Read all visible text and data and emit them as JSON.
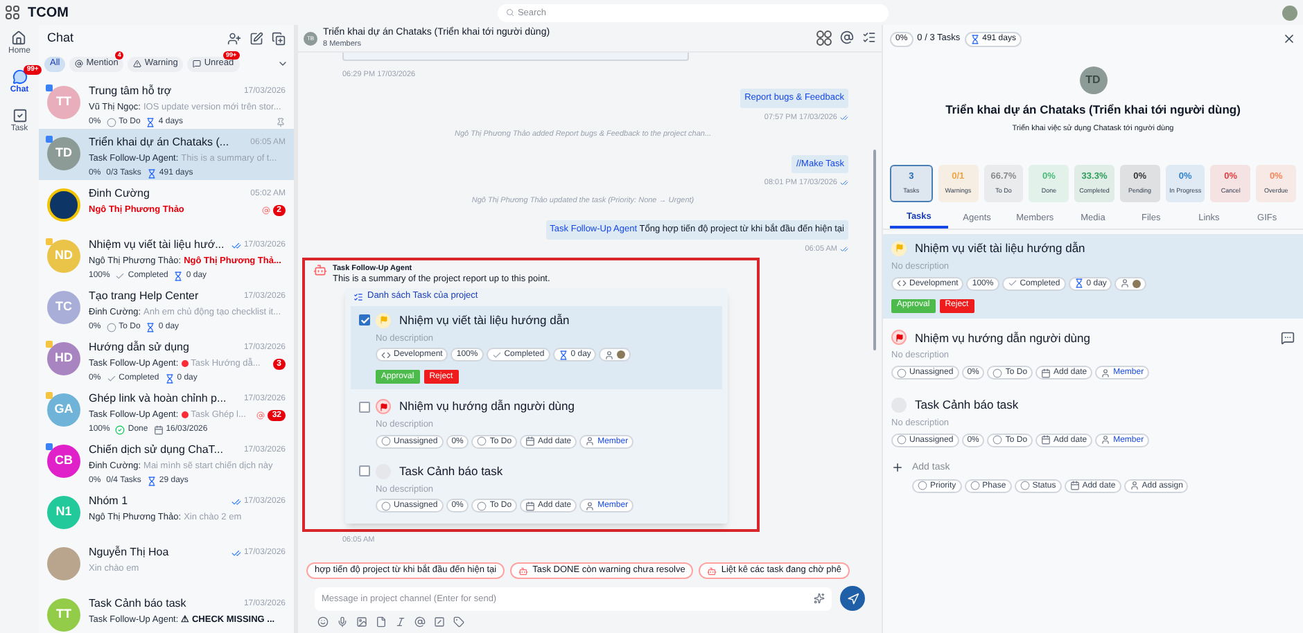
{
  "app": {
    "title": "TCOM"
  },
  "search": {
    "placeholder": "Search"
  },
  "rail": [
    {
      "label": "Home",
      "selected": false
    },
    {
      "label": "Chat",
      "selected": true,
      "badge": "99+"
    },
    {
      "label": "Task",
      "selected": false
    }
  ],
  "chat_list": {
    "title": "Chat",
    "filters": [
      {
        "label": "All",
        "selected": true
      },
      {
        "label": "Mention",
        "selected": false,
        "badge": "4"
      },
      {
        "label": "Warning",
        "selected": false
      },
      {
        "label": "Unread",
        "selected": false,
        "badge": "99+"
      }
    ],
    "conversations": [
      {
        "kind": "initials",
        "initials": "TT",
        "color": "#e8aebb",
        "tag": {
          "color": "#3b82f6"
        },
        "name": "Trung tâm hỗ trợ",
        "time": "17/03/2026",
        "sender": "Vũ Thị Ngọc:",
        "preview": "IOS update version mới trên stor...",
        "selected": false,
        "pinned": true,
        "meta": [
          {
            "kind": "percent",
            "text": "0%"
          },
          {
            "kind": "todo",
            "text": "To Do"
          },
          {
            "kind": "duration",
            "text": "4 days"
          }
        ]
      },
      {
        "kind": "initials",
        "initials": "TD",
        "color": "#8c9b96",
        "tag": {
          "color": "#3b82f6"
        },
        "name": "Triển khai dự án Chataks (...",
        "time": "06:05 AM",
        "sender": "Task Follow-Up Agent:",
        "preview": "This is a summary of t...",
        "selected": true,
        "meta": [
          {
            "kind": "percent",
            "text": "0%"
          },
          {
            "kind": "tasks",
            "text": "0/3 Tasks"
          },
          {
            "kind": "duration",
            "text": "491 days"
          }
        ]
      },
      {
        "kind": "logo",
        "name": "Đinh Cường",
        "time": "05:02 AM",
        "preview": "Ngô Thị Phương Thảo",
        "alert": true,
        "selected": false,
        "mention": true,
        "badge": "2"
      },
      {
        "kind": "initials",
        "initials": "ND",
        "color": "#e9c449",
        "tag": {
          "color": "#f5c542"
        },
        "name": "Nhiệm vụ viết tài liệu hướ...",
        "time": "17/03/2026",
        "ticks": true,
        "sender": "Ngô Thị Phương Thảo:",
        "preview": "Ngô Thị Phương Thả...",
        "alert": true,
        "selected": false,
        "meta": [
          {
            "kind": "percent",
            "text": "100%"
          },
          {
            "kind": "completed",
            "text": "Completed"
          },
          {
            "kind": "duration",
            "text": "0 day"
          }
        ]
      },
      {
        "kind": "initials",
        "initials": "TC",
        "color": "#a9aed8",
        "name": "Tạo trang Help Center",
        "time": "17/03/2026",
        "sender": "Đinh Cường:",
        "preview": "Anh em chủ động tạo checklist it...",
        "selected": false,
        "meta": [
          {
            "kind": "percent",
            "text": "0%"
          },
          {
            "kind": "todo",
            "text": "To Do"
          },
          {
            "kind": "duration",
            "text": "0 day"
          }
        ]
      },
      {
        "kind": "initials",
        "initials": "HD",
        "color": "#a884c0",
        "tag": {
          "color": "#f5c542"
        },
        "name": "Hướng dẫn sử dụng",
        "time": "17/03/2026",
        "sender": "Task Follow-Up Agent:",
        "alert_dot": true,
        "preview": "Task Hướng dẫ...",
        "selected": false,
        "badge": "3",
        "meta": [
          {
            "kind": "percent",
            "text": "0%"
          },
          {
            "kind": "completed",
            "text": "Completed"
          },
          {
            "kind": "duration",
            "text": "0 day"
          }
        ]
      },
      {
        "kind": "initials",
        "initials": "GA",
        "color": "#6fb3d8",
        "tag": {
          "color": "#f5c542"
        },
        "name": "Ghép link và hoàn chỉnh p...",
        "time": "17/03/2026",
        "sender": "Task Follow-Up Agent:",
        "alert_dot": true,
        "preview": "Task Ghép l...",
        "selected": false,
        "mention": true,
        "badge": "32",
        "meta": [
          {
            "kind": "percent",
            "text": "100%"
          },
          {
            "kind": "done",
            "text": "Done"
          },
          {
            "kind": "date",
            "text": "16/03/2026"
          }
        ]
      },
      {
        "kind": "initials",
        "initials": "CB",
        "color": "#e020c8",
        "tag": {
          "color": "#3b82f6"
        },
        "name": "Chiến dịch sử dụng ChaT...",
        "time": "17/03/2026",
        "sender": "Đinh Cường:",
        "preview": "Mai mình sẽ start chiến dịch này",
        "selected": false,
        "meta": [
          {
            "kind": "percent",
            "text": "0%"
          },
          {
            "kind": "tasks",
            "text": "0/4 Tasks"
          },
          {
            "kind": "duration",
            "text": "29 days"
          }
        ]
      },
      {
        "kind": "initials",
        "initials": "N1",
        "color": "#22c99a",
        "name": "Nhóm 1",
        "time": "17/03/2026",
        "ticks": true,
        "sender": "Ngô Thị Phương Thảo:",
        "preview": "Xin chào 2 em",
        "selected": false
      },
      {
        "kind": "photo",
        "name": "Nguyễn Thị Hoa",
        "time": "17/03/2026",
        "ticks": true,
        "preview": "Xin chào em",
        "selected": false
      },
      {
        "kind": "initials",
        "initials": "TT",
        "color": "#93cc48",
        "name": "Task Cảnh báo task",
        "time": "17/03/2026",
        "sender": "Task Follow-Up Agent:",
        "preview": "⚠ CHECK MISSING ...",
        "bold": true,
        "selected": false
      }
    ]
  },
  "channel": {
    "initials": "TB",
    "title": "Triển khai dự án Chataks (Triển khai tới người dùng)",
    "members": "8 Members",
    "first_time": "06:29 PM 17/03/2026",
    "messages": [
      {
        "kind": "outgoing",
        "link": true,
        "text": "Report bugs & Feedback",
        "time": "07:57 PM 17/03/2026",
        "read": true
      },
      {
        "kind": "system",
        "text": "Ngô Thị Phương Thảo added Report bugs & Feedback to the project chan..."
      },
      {
        "kind": "outgoing",
        "link": true,
        "text": "//Make Task",
        "time": "08:01 PM 17/03/2026",
        "read": true
      },
      {
        "kind": "system",
        "text": "Ngô Thị Phương Thảo updated the task (Priority: None → Urgent)"
      },
      {
        "kind": "outgoing",
        "mention": "Task Follow-Up Agent",
        "text": "Tổng hợp tiến độ project từ khi bắt đầu đến hiện tại",
        "time": "06:05 AM",
        "read": true
      }
    ],
    "agent_message": {
      "highlighted": true,
      "sender": "Task Follow-Up Agent",
      "text": "This is a summary of the project report up to this point.",
      "card_title": "Danh sách Task của project",
      "time": "06:05 AM",
      "tasks": [
        {
          "kind": "medium",
          "title": "Nhiệm vụ viết tài liệu hướng dẫn",
          "checked": true,
          "selected": true,
          "description": "No description",
          "chips": [
            {
              "kind": "phase",
              "text": "Development"
            },
            {
              "kind": "percent",
              "text": "100%"
            },
            {
              "kind": "completed",
              "text": "Completed"
            },
            {
              "kind": "duration",
              "text": "0 day"
            },
            {
              "kind": "assignee"
            }
          ],
          "actions": [
            {
              "kind": "approve",
              "label": "Approval"
            },
            {
              "kind": "reject",
              "label": "Reject"
            }
          ]
        },
        {
          "kind": "urgent",
          "title": "Nhiệm vụ hướng dẫn người dùng",
          "checked": false,
          "selected": false,
          "description": "No description",
          "chips": [
            {
              "kind": "unassigned",
              "text": "Unassigned"
            },
            {
              "kind": "percent",
              "text": "0%"
            },
            {
              "kind": "todo",
              "text": "To Do"
            },
            {
              "kind": "date",
              "text": "Add date"
            },
            {
              "kind": "member",
              "text": "Member"
            }
          ]
        },
        {
          "kind": "none",
          "title": "Task Cảnh báo task",
          "checked": false,
          "selected": false,
          "description": "No description",
          "chips": [
            {
              "kind": "unassigned",
              "text": "Unassigned"
            },
            {
              "kind": "percent",
              "text": "0%"
            },
            {
              "kind": "todo",
              "text": "To Do"
            },
            {
              "kind": "date",
              "text": "Add date"
            },
            {
              "kind": "member",
              "text": "Member"
            }
          ]
        }
      ]
    },
    "suggestions": [
      "hợp tiến độ project từ khi bắt đầu đến hiện tại",
      "Task DONE còn warning chưa resolve",
      "Liệt kê các task đang chờ phê"
    ],
    "composer": {
      "placeholder": "Message in project channel (Enter for send)"
    }
  },
  "details": {
    "progress": "0%",
    "tasks_count": "0 / 3 Tasks",
    "duration": "491 days",
    "initials": "TD",
    "title": "Triển khai dự án Chataks (Triển khai tới người dùng)",
    "subtitle": "Triển khai việc sử dụng Chatask tới người dùng",
    "stats": [
      {
        "value": "3",
        "label": "Tasks",
        "color": "#2b6cb0",
        "selected": true
      },
      {
        "value": "0/1",
        "label": "Warnings",
        "color": "#f0a340",
        "selected": false
      },
      {
        "value": "66.7%",
        "label": "To Do",
        "color": "#8a8a8a",
        "selected": false
      },
      {
        "value": "0%",
        "label": "Done",
        "color": "#48bb78",
        "selected": false
      },
      {
        "value": "33.3%",
        "label": "Completed",
        "color": "#2f9e5c",
        "selected": false
      },
      {
        "value": "0%",
        "label": "Pending",
        "color": "#333333",
        "selected": false
      },
      {
        "value": "0%",
        "label": "In Progress",
        "color": "#3182ce",
        "selected": false
      },
      {
        "value": "0%",
        "label": "Cancel",
        "color": "#e53e3e",
        "selected": false
      },
      {
        "value": "0%",
        "label": "Overdue",
        "color": "#f6865a",
        "selected": false
      }
    ],
    "tabs": [
      {
        "label": "Tasks",
        "selected": true
      },
      {
        "label": "Agents",
        "selected": false
      },
      {
        "label": "Members",
        "selected": false
      },
      {
        "label": "Media",
        "selected": false
      },
      {
        "label": "Files",
        "selected": false
      },
      {
        "label": "Links",
        "selected": false
      },
      {
        "label": "GIFs",
        "selected": false
      }
    ],
    "tasks": [
      {
        "kind": "medium",
        "title": "Nhiệm vụ viết tài liệu hướng dẫn",
        "selected": true,
        "description": "No description",
        "chips": [
          {
            "kind": "phase",
            "text": "Development"
          },
          {
            "kind": "percent",
            "text": "100%"
          },
          {
            "kind": "completed",
            "text": "Completed"
          },
          {
            "kind": "duration",
            "text": "0 day"
          },
          {
            "kind": "assignee"
          }
        ],
        "actions": [
          {
            "kind": "approve",
            "label": "Approval"
          },
          {
            "kind": "reject",
            "label": "Reject"
          }
        ]
      },
      {
        "kind": "urgent",
        "title": "Nhiệm vụ hướng dẫn người dùng",
        "selected": false,
        "comment_icon": true,
        "description": "No description",
        "chips": [
          {
            "kind": "unassigned",
            "text": "Unassigned"
          },
          {
            "kind": "percent",
            "text": "0%"
          },
          {
            "kind": "todo",
            "text": "To Do"
          },
          {
            "kind": "date",
            "text": "Add date"
          },
          {
            "kind": "member",
            "text": "Member"
          }
        ]
      },
      {
        "kind": "none",
        "title": "Task Cảnh báo task",
        "selected": false,
        "description": "No description",
        "chips": [
          {
            "kind": "unassigned",
            "text": "Unassigned"
          },
          {
            "kind": "percent",
            "text": "0%"
          },
          {
            "kind": "todo",
            "text": "To Do"
          },
          {
            "kind": "date",
            "text": "Add date"
          },
          {
            "kind": "member",
            "text": "Member"
          }
        ]
      }
    ],
    "add_task": {
      "placeholder": "Add task",
      "chips": [
        {
          "kind": "priority",
          "text": "Priority"
        },
        {
          "kind": "unassigned",
          "text": "Phase"
        },
        {
          "kind": "status",
          "text": "Status"
        },
        {
          "kind": "date",
          "text": "Add date"
        },
        {
          "kind": "assign",
          "text": "Add assign"
        }
      ]
    }
  }
}
